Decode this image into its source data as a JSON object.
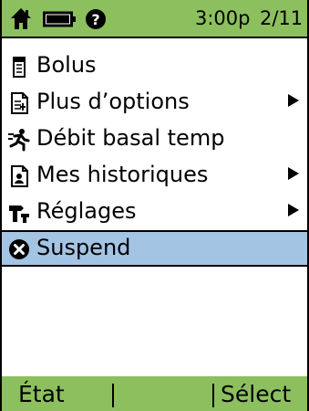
{
  "status_bar": {
    "time": "3:00p",
    "date": "2/11",
    "icons": [
      "home-icon",
      "battery-icon",
      "help-icon"
    ],
    "color": "#8cc05e"
  },
  "menu": {
    "items": [
      {
        "label": "Bolus",
        "icon": "bolus-icon",
        "has_submenu": false,
        "selected": false
      },
      {
        "label": "Plus d’options",
        "icon": "options-document-icon",
        "has_submenu": true,
        "selected": false
      },
      {
        "label": "Débit basal temp",
        "icon": "temp-basal-activity-icon",
        "has_submenu": false,
        "selected": false
      },
      {
        "label": "Mes historiques",
        "icon": "history-document-icon",
        "has_submenu": true,
        "selected": false
      },
      {
        "label": "Réglages",
        "icon": "settings-tools-icon",
        "has_submenu": true,
        "selected": false
      },
      {
        "label": "Suspend",
        "icon": "suspend-circle-x-icon",
        "has_submenu": false,
        "selected": true
      }
    ],
    "selection_color": "#a4c4e4"
  },
  "softkeys": {
    "left_label": "État",
    "right_label": "Sélect",
    "color": "#8cc05e"
  }
}
